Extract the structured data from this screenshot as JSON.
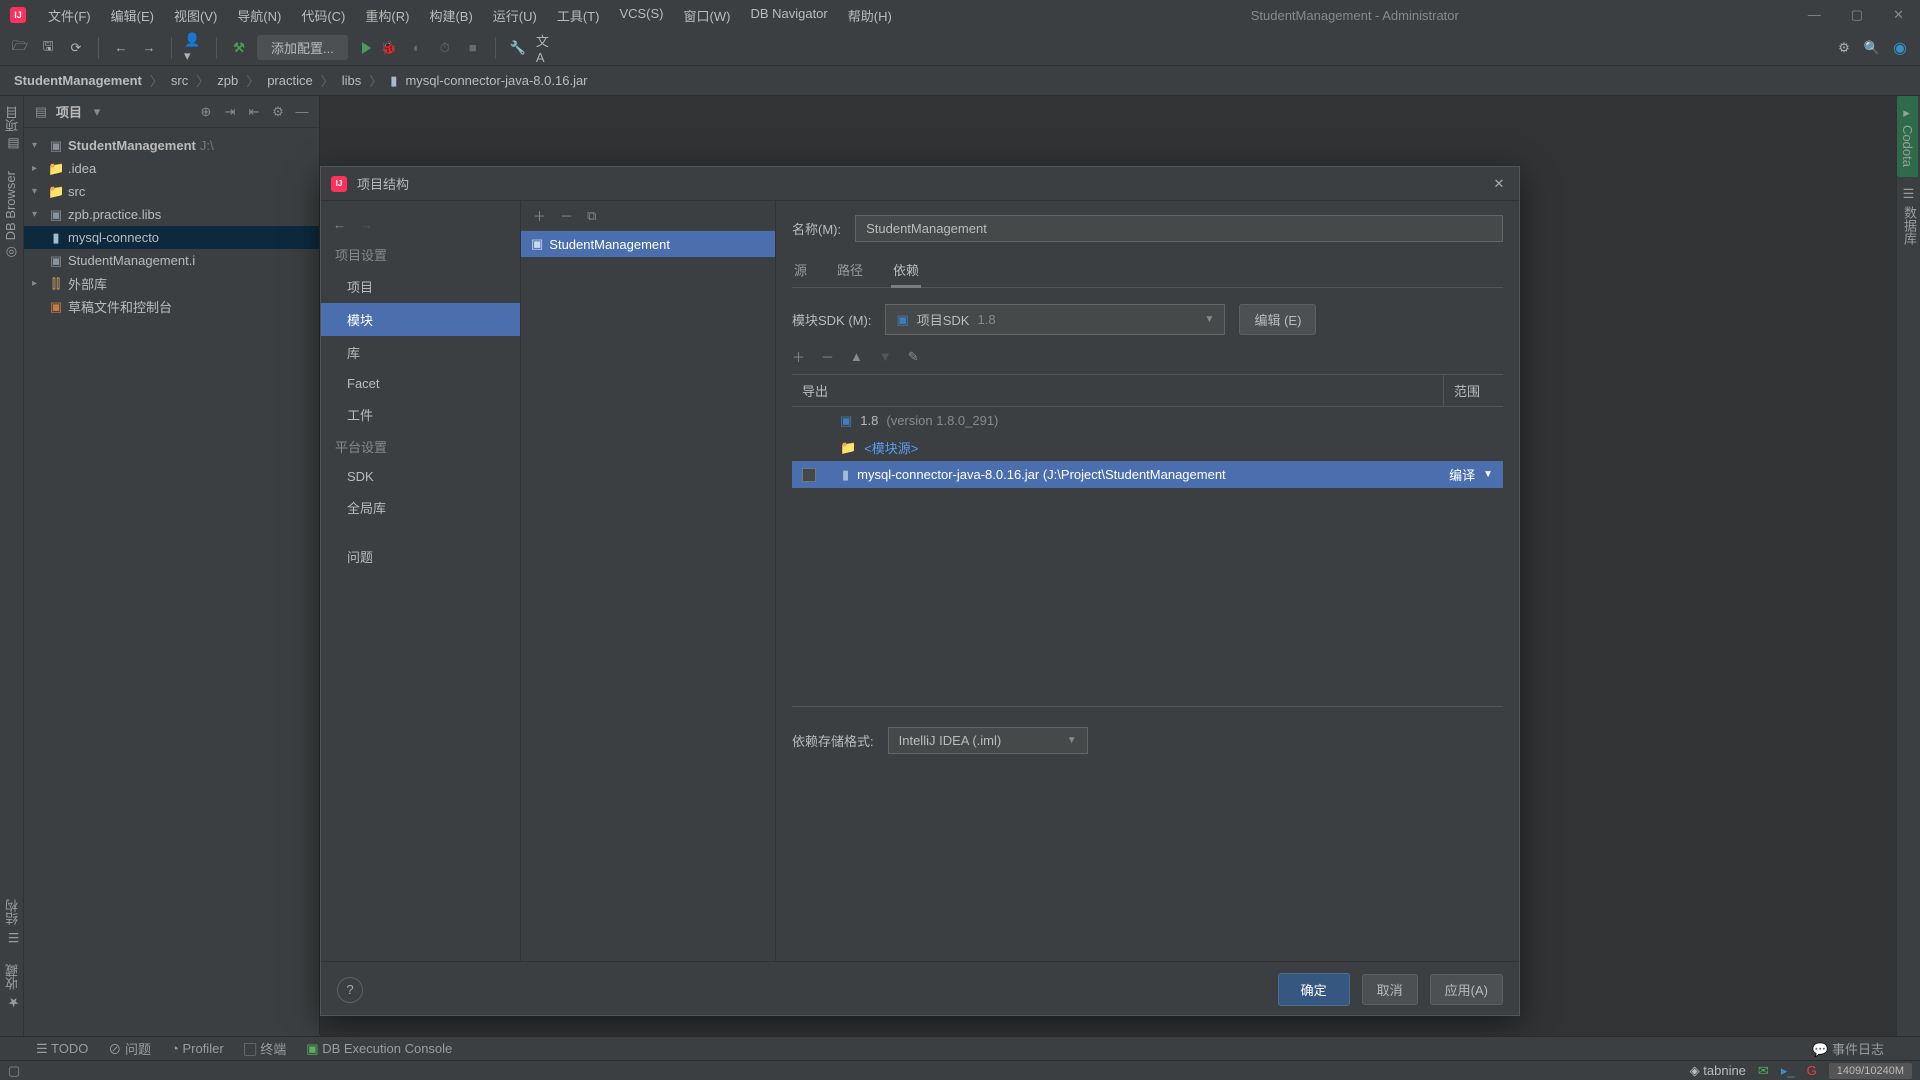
{
  "titlebar": {
    "menus": [
      "文件(F)",
      "编辑(E)",
      "视图(V)",
      "导航(N)",
      "代码(C)",
      "重构(R)",
      "构建(B)",
      "运行(U)",
      "工具(T)",
      "VCS(S)",
      "窗口(W)",
      "DB Navigator",
      "帮助(H)"
    ],
    "window_title": "StudentManagement - Administrator"
  },
  "toolbar": {
    "config_label": "添加配置..."
  },
  "breadcrumb": [
    "StudentManagement",
    "src",
    "zpb",
    "practice",
    "libs",
    "mysql-connector-java-8.0.16.jar"
  ],
  "left_vertical_tabs": [
    "项目",
    "DB Browser"
  ],
  "left_vertical_tabs_bottom": [
    "结构",
    "收藏"
  ],
  "right_vertical_tabs": [
    "Codota",
    "数据库"
  ],
  "project_panel": {
    "title": "项目",
    "tree": {
      "root": "StudentManagement",
      "root_hint": "J:\\",
      "idea": ".idea",
      "src": "src",
      "pkg": "zpb.practice.libs",
      "jar": "mysql-connecto",
      "iml": "StudentManagement.i",
      "ext_libs": "外部库",
      "scratch": "草稿文件和控制台"
    }
  },
  "dialog": {
    "title": "项目结构",
    "nav": {
      "cat1": "项目设置",
      "project": "项目",
      "modules": "模块",
      "libs": "库",
      "facet": "Facet",
      "artifacts": "工件",
      "cat2": "平台设置",
      "sdk": "SDK",
      "globalLibs": "全局库",
      "problems": "问题"
    },
    "module_name": "StudentManagement",
    "name_label": "名称(M):",
    "tabs": {
      "source": "源",
      "paths": "路径",
      "deps": "依赖"
    },
    "sdk_label": "模块SDK (M):",
    "sdk_value_prefix": "项目SDK",
    "sdk_value_ver": "1.8",
    "edit_btn": "编辑 (E)",
    "dep_cols": {
      "export": "导出",
      "scope": "范围"
    },
    "deps": {
      "jdk": "1.8",
      "jdk_hint": "(version 1.8.0_291)",
      "modsrc": "<模块源>",
      "jar": "mysql-connector-java-8.0.16.jar (J:\\Project\\StudentManagement",
      "jar_scope": "编译"
    },
    "storage_label": "依赖存储格式:",
    "storage_value": "IntelliJ IDEA (.iml)",
    "ok": "确定",
    "cancel": "取消",
    "apply": "应用(A)"
  },
  "status": {
    "todo": "TODO",
    "problems": "问题",
    "profiler": "Profiler",
    "terminal": "终端",
    "dbconsole": "DB Execution Console",
    "eventlog": "事件日志",
    "tabnine": "tabnine",
    "memory": "1409/10240M"
  }
}
